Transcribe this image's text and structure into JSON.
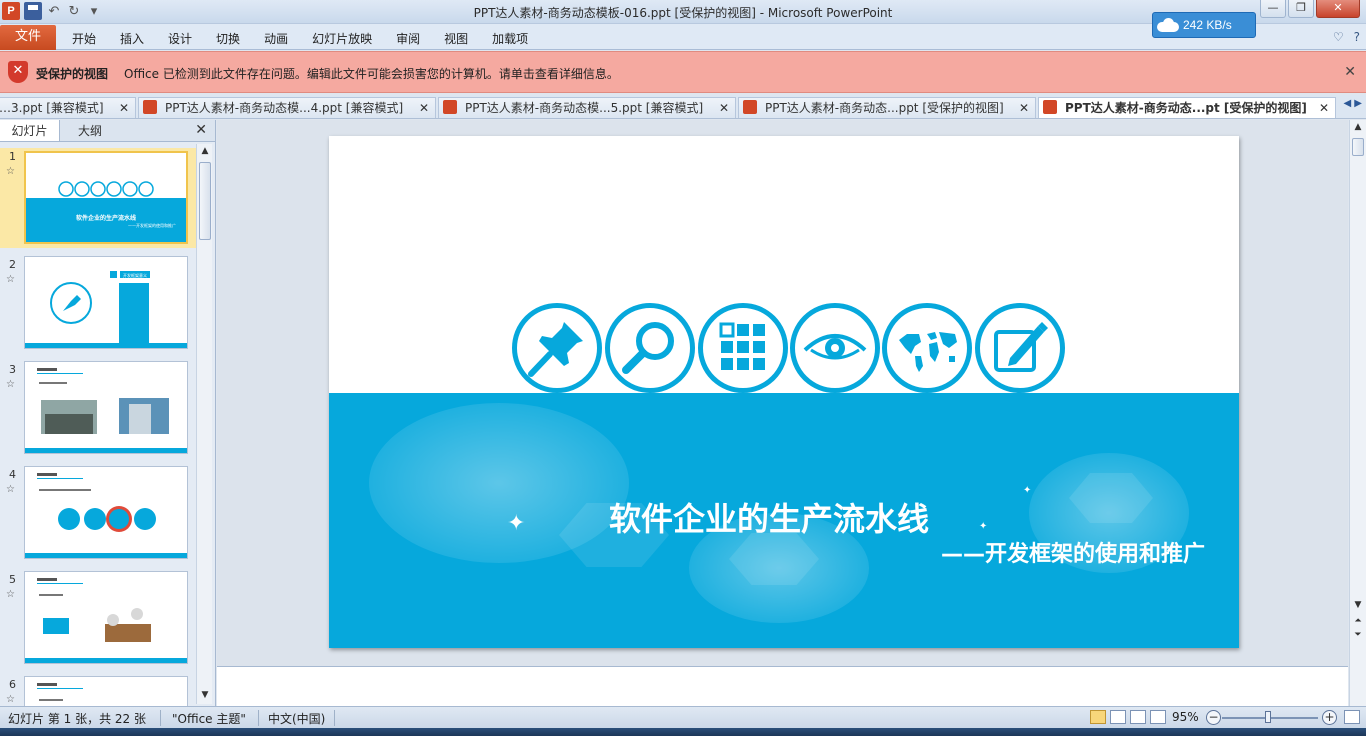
{
  "window": {
    "title": "PPT达人素材-商务动态模板-016.ppt [受保护的视图]  -  Microsoft PowerPoint",
    "net_speed": "242 KB/s",
    "controls": {
      "minimize": "—",
      "restore": "❐",
      "close": "✕"
    }
  },
  "qat": {
    "app_icon": "P",
    "undo": "↶",
    "redo": "↻",
    "more": "▾"
  },
  "ribbon": {
    "file_tab": "文件",
    "tabs": [
      "开始",
      "插入",
      "设计",
      "切换",
      "动画",
      "幻灯片放映",
      "审阅",
      "视图",
      "加载项"
    ],
    "help": "?"
  },
  "protected_view": {
    "label": "受保护的视图",
    "message": "Office 已检测到此文件存在问题。编辑此文件可能会损害您的计算机。请单击查看详细信息。",
    "close": "✕"
  },
  "doc_tabs": [
    {
      "label": "…3.ppt [兼容模式]"
    },
    {
      "label": "PPT达人素材-商务动态模...4.ppt [兼容模式]"
    },
    {
      "label": "PPT达人素材-商务动态模...5.ppt [兼容模式]"
    },
    {
      "label": "PPT达人素材-商务动态...ppt [受保护的视图]"
    },
    {
      "label": "PPT达人素材-商务动态...pt [受保护的视图]",
      "active": true
    }
  ],
  "left_panel": {
    "tabs": [
      "幻灯片",
      "大纲"
    ],
    "close": "✕",
    "slides": [
      "1",
      "2",
      "3",
      "4",
      "5",
      "6"
    ],
    "star": "☆",
    "thumb1": {
      "title": "软件企业的生产流水线",
      "subtitle": "——开发框架的使用和推广"
    },
    "thumb2": {
      "label": "开发框架意义"
    }
  },
  "slide": {
    "title": "软件企业的生产流水线",
    "subtitle": "——开发框架的使用和推广",
    "icons": [
      "pushpin-icon",
      "magnifier-icon",
      "grid-icon",
      "eye-icon",
      "world-map-icon",
      "edit-icon"
    ],
    "accent": "#06a8dc"
  },
  "status": {
    "slide_info": "幻灯片 第 1 张，共 22 张",
    "theme": "\"Office 主题\"",
    "language": "中文(中国)",
    "zoom": "95%",
    "zoom_out": "−",
    "zoom_in": "+"
  }
}
